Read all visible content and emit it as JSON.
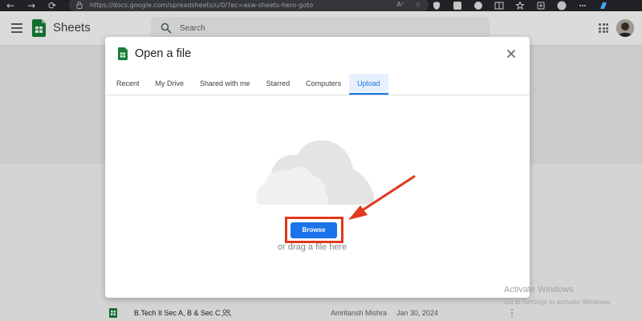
{
  "browser": {
    "url": "https://docs.google.com/spreadsheets/u/0/?ec=asw-sheets-hero-goto",
    "reader_label": "Aᴬ"
  },
  "app": {
    "title": "Sheets",
    "search_placeholder": "Search"
  },
  "dialog": {
    "title": "Open a file",
    "tabs": [
      {
        "label": "Recent",
        "active": false
      },
      {
        "label": "My Drive",
        "active": false
      },
      {
        "label": "Shared with me",
        "active": false
      },
      {
        "label": "Starred",
        "active": false
      },
      {
        "label": "Computers",
        "active": false
      },
      {
        "label": "Upload",
        "active": true
      }
    ],
    "browse_label": "Browse",
    "drag_text": "or drag a file here"
  },
  "file_row": {
    "name": "B.Tech II Sec A, B & Sec C",
    "owner": "Amritansh Mishra",
    "date": "Jan 30, 2024"
  },
  "watermark": {
    "title": "Activate Windows",
    "subtitle": "Go to Settings to activate Windows."
  },
  "colors": {
    "accent": "#1a73e8",
    "annotation": "#e0391d",
    "sheets_green": "#188038"
  }
}
